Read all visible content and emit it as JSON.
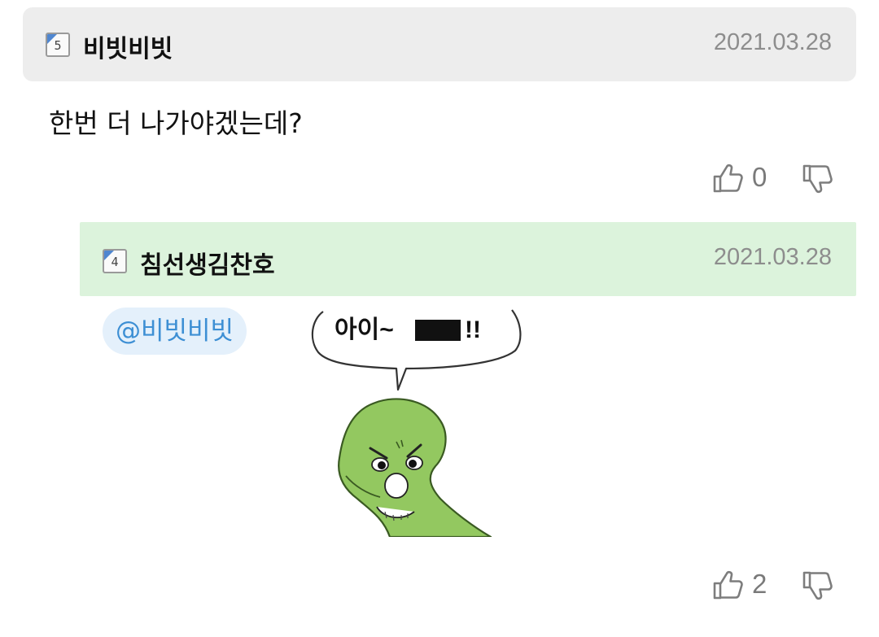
{
  "comments": [
    {
      "level": "5",
      "author": "비빗비빗",
      "date": "2021.03.28",
      "text": "한번 더 나가야겠는데?",
      "likes": "0"
    }
  ],
  "reply": {
    "level": "4",
    "author": "침선생김찬호",
    "date": "2021.03.28",
    "mention": "@비빗비빗",
    "meme": {
      "speech": "아이~",
      "speech_end": "!!"
    },
    "likes": "2"
  },
  "icons": {
    "like": "thumbs-up-icon",
    "dislike": "thumbs-down-icon",
    "level_badge": "level-badge-icon"
  },
  "colors": {
    "comment_header_bg": "#ededed",
    "reply_header_bg": "#dcf3dc",
    "mention_text": "#3d8fd4",
    "mention_bg": "#e4f0fb",
    "date_text": "#8d8d8d",
    "character_green": "#93c860"
  }
}
